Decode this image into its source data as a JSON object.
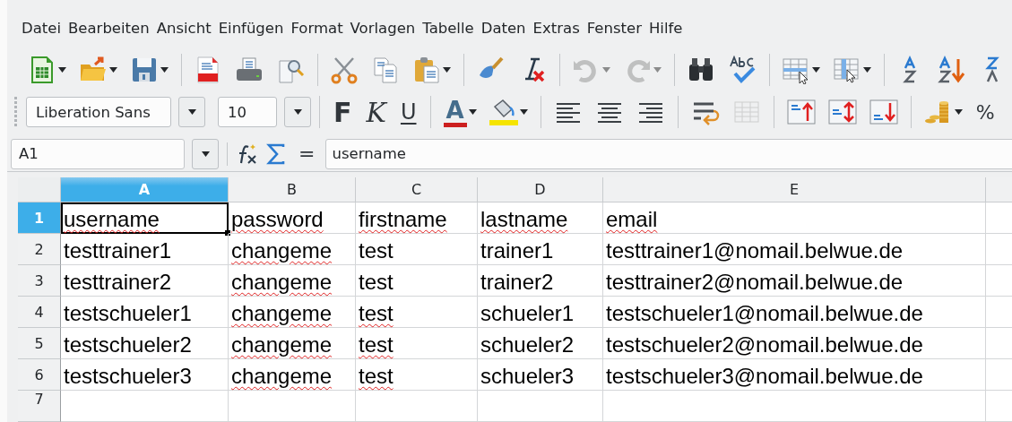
{
  "menu": [
    {
      "label": "Datei"
    },
    {
      "label": "Bearbeiten"
    },
    {
      "label": "Ansicht"
    },
    {
      "label": "Einfügen"
    },
    {
      "label": "Format"
    },
    {
      "label": "Vorlagen"
    },
    {
      "label": "Tabelle"
    },
    {
      "label": "Daten"
    },
    {
      "label": "Extras"
    },
    {
      "label": "Fenster"
    },
    {
      "label": "Hilfe"
    }
  ],
  "standard_toolbar": [
    {
      "kind": "new",
      "dropdown": true,
      "disabled": false
    },
    {
      "kind": "open",
      "dropdown": true,
      "disabled": false
    },
    {
      "kind": "save",
      "dropdown": true,
      "disabled": false
    },
    {
      "kind": "separator"
    },
    {
      "kind": "pdf",
      "disabled": false
    },
    {
      "kind": "print",
      "disabled": false
    },
    {
      "kind": "preview",
      "disabled": false
    },
    {
      "kind": "separator"
    },
    {
      "kind": "cut",
      "disabled": false
    },
    {
      "kind": "copy",
      "disabled": false
    },
    {
      "kind": "paste",
      "dropdown": true,
      "disabled": false
    },
    {
      "kind": "separator"
    },
    {
      "kind": "brush",
      "disabled": false
    },
    {
      "kind": "clearformat",
      "disabled": false
    },
    {
      "kind": "separator"
    },
    {
      "kind": "undo",
      "dropdown": true,
      "disabled": true
    },
    {
      "kind": "redo",
      "dropdown": true,
      "disabled": true
    },
    {
      "kind": "separator"
    },
    {
      "kind": "find",
      "disabled": false
    },
    {
      "kind": "spelling",
      "disabled": false
    },
    {
      "kind": "separator"
    },
    {
      "kind": "rows",
      "dropdown": true,
      "disabled": false
    },
    {
      "kind": "columns",
      "dropdown": true,
      "disabled": false
    },
    {
      "kind": "separator"
    },
    {
      "kind": "sortaz",
      "disabled": false
    },
    {
      "kind": "sortdesc",
      "disabled": false
    },
    {
      "kind": "sortza",
      "disabled": false
    }
  ],
  "formatting_toolbar": {
    "font_name": "Liberation Sans",
    "font_size": "10",
    "items": [
      {
        "kind": "separator"
      },
      {
        "kind": "bold",
        "label": "F",
        "disabled": false
      },
      {
        "kind": "italic",
        "label": "K",
        "disabled": false
      },
      {
        "kind": "underline",
        "label": "U",
        "disabled": false
      },
      {
        "kind": "separator"
      },
      {
        "kind": "fontcolor",
        "label": "A",
        "color": "#cc1f1f",
        "dropdown": true,
        "disabled": false
      },
      {
        "kind": "highlight",
        "color": "#f5e400",
        "dropdown": true,
        "disabled": false
      },
      {
        "kind": "separator"
      },
      {
        "kind": "alignleft",
        "disabled": false
      },
      {
        "kind": "aligncenter",
        "disabled": false
      },
      {
        "kind": "alignright",
        "disabled": false
      },
      {
        "kind": "separator"
      },
      {
        "kind": "wrap",
        "disabled": false
      },
      {
        "kind": "merge",
        "disabled": true
      },
      {
        "kind": "separator"
      },
      {
        "kind": "aligntop",
        "disabled": false
      },
      {
        "kind": "alignmiddle",
        "disabled": false
      },
      {
        "kind": "alignbottom",
        "disabled": false
      },
      {
        "kind": "separator"
      },
      {
        "kind": "currency",
        "dropdown": true,
        "disabled": false
      },
      {
        "kind": "percent",
        "label": "%",
        "disabled": false
      }
    ]
  },
  "formula_bar": {
    "name_box": "A1",
    "equals": "=",
    "value": "username"
  },
  "sheet": {
    "columns": [
      {
        "label": "A",
        "selected": true
      },
      {
        "label": "B",
        "selected": false
      },
      {
        "label": "C",
        "selected": false
      },
      {
        "label": "D",
        "selected": false
      },
      {
        "label": "E",
        "selected": false
      }
    ],
    "rows": [
      {
        "label": "1",
        "selected": true,
        "cells": [
          {
            "text": "username",
            "misspelled": true,
            "active": true
          },
          {
            "text": "password",
            "misspelled": true,
            "active": false
          },
          {
            "text": "firstname",
            "misspelled": true,
            "active": false
          },
          {
            "text": "lastname",
            "misspelled": true,
            "active": false
          },
          {
            "text": "email",
            "misspelled": true,
            "active": false
          }
        ]
      },
      {
        "label": "2",
        "selected": false,
        "cells": [
          {
            "text": "testtrainer1",
            "misspelled": false,
            "active": false
          },
          {
            "text": "changeme",
            "misspelled": true,
            "active": false
          },
          {
            "text": "test",
            "misspelled": false,
            "active": false
          },
          {
            "text": "trainer1",
            "misspelled": false,
            "active": false
          },
          {
            "text": "testtrainer1@nomail.belwue.de",
            "misspelled": false,
            "active": false
          }
        ]
      },
      {
        "label": "3",
        "selected": false,
        "cells": [
          {
            "text": "testtrainer2",
            "misspelled": false,
            "active": false
          },
          {
            "text": "changeme",
            "misspelled": true,
            "active": false
          },
          {
            "text": "test",
            "misspelled": false,
            "active": false
          },
          {
            "text": "trainer2",
            "misspelled": false,
            "active": false
          },
          {
            "text": "testtrainer2@nomail.belwue.de",
            "misspelled": false,
            "active": false
          }
        ]
      },
      {
        "label": "4",
        "selected": false,
        "cells": [
          {
            "text": "testschueler1",
            "misspelled": false,
            "active": false
          },
          {
            "text": "changeme",
            "misspelled": true,
            "active": false
          },
          {
            "text": "test",
            "misspelled": true,
            "active": false
          },
          {
            "text": "schueler1",
            "misspelled": false,
            "active": false
          },
          {
            "text": "testschueler1@nomail.belwue.de",
            "misspelled": false,
            "active": false
          }
        ]
      },
      {
        "label": "5",
        "selected": false,
        "cells": [
          {
            "text": "testschueler2",
            "misspelled": false,
            "active": false
          },
          {
            "text": "changeme",
            "misspelled": true,
            "active": false
          },
          {
            "text": "test",
            "misspelled": true,
            "active": false
          },
          {
            "text": "schueler2",
            "misspelled": false,
            "active": false
          },
          {
            "text": "testschueler2@nomail.belwue.de",
            "misspelled": false,
            "active": false
          }
        ]
      },
      {
        "label": "6",
        "selected": false,
        "cells": [
          {
            "text": "testschueler3",
            "misspelled": false,
            "active": false
          },
          {
            "text": "changeme",
            "misspelled": true,
            "active": false
          },
          {
            "text": "test",
            "misspelled": true,
            "active": false
          },
          {
            "text": "schueler3",
            "misspelled": false,
            "active": false
          },
          {
            "text": "testschueler3@nomail.belwue.de",
            "misspelled": false,
            "active": false
          }
        ]
      },
      {
        "label": "7",
        "selected": false,
        "cells": []
      }
    ]
  }
}
